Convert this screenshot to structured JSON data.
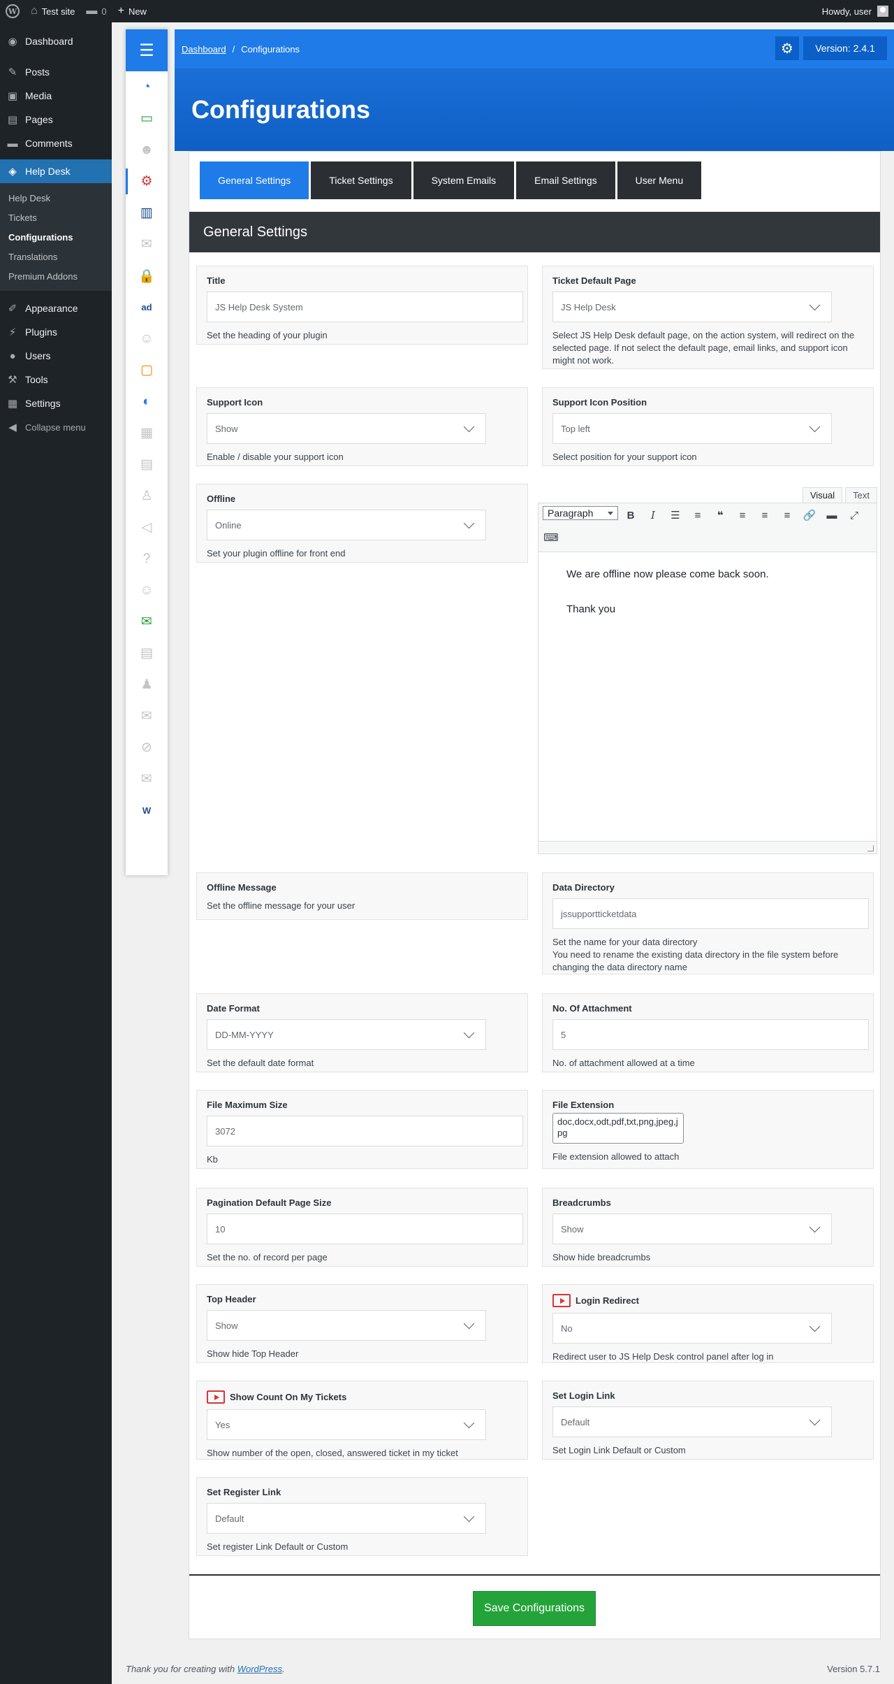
{
  "adminbar": {
    "site_name": "Test site",
    "comments_count": "0",
    "new_label": "New",
    "howdy": "Howdy, user"
  },
  "sidebar": {
    "items_top": [
      {
        "label": "Dashboard",
        "icon": "dashboard-icon",
        "glyph": "◉"
      },
      {
        "label": "Posts",
        "icon": "pin-icon",
        "glyph": "✎"
      },
      {
        "label": "Media",
        "icon": "media-icon",
        "glyph": "▣"
      },
      {
        "label": "Pages",
        "icon": "pages-icon",
        "glyph": "▤"
      },
      {
        "label": "Comments",
        "icon": "comment-icon",
        "glyph": "▬"
      }
    ],
    "current": {
      "label": "Help Desk",
      "icon": "ticket-icon",
      "glyph": "◈"
    },
    "submenu": [
      "Help Desk",
      "Tickets",
      "Configurations",
      "Translations",
      "Premium Addons"
    ],
    "items_bottom": [
      {
        "label": "Appearance",
        "icon": "brush-icon",
        "glyph": "✐"
      },
      {
        "label": "Plugins",
        "icon": "plug-icon",
        "glyph": "⚡"
      },
      {
        "label": "Users",
        "icon": "user-icon",
        "glyph": "●"
      },
      {
        "label": "Tools",
        "icon": "wrench-icon",
        "glyph": "⚒"
      },
      {
        "label": "Settings",
        "icon": "settings-icon",
        "glyph": "▦"
      }
    ],
    "collapse": "Collapse menu"
  },
  "strip_icons": [
    {
      "name": "dashboard-gauge-icon",
      "glyph": "◔",
      "color": "#1e7be8"
    },
    {
      "name": "tickets-icon",
      "glyph": "▭",
      "color": "#24a33a"
    },
    {
      "name": "agents-icon",
      "glyph": "☻",
      "color": "#c3c4c7"
    },
    {
      "name": "configurations-gear-icon",
      "glyph": "⚙",
      "color": "#d63638"
    },
    {
      "name": "reports-chart-icon",
      "glyph": "▥",
      "color": "#1e4d8c"
    },
    {
      "name": "email-icon",
      "glyph": "✉",
      "color": "#c3c4c7"
    },
    {
      "name": "lock-icon",
      "glyph": "🔒",
      "color": "#f0b400"
    },
    {
      "name": "ad-icon",
      "glyph": "ad",
      "color": "#1e4d8c"
    },
    {
      "name": "smile-icon",
      "glyph": "☺",
      "color": "#c3c4c7"
    },
    {
      "name": "id-card-icon",
      "glyph": "▢",
      "color": "#f08c00"
    },
    {
      "name": "circle-c-icon",
      "glyph": "◐",
      "color": "#1e7be8"
    },
    {
      "name": "grid-icon",
      "glyph": "▦",
      "color": "#c3c4c7"
    },
    {
      "name": "document-icon",
      "glyph": "▤",
      "color": "#c3c4c7"
    },
    {
      "name": "user-upload-icon",
      "glyph": "♙",
      "color": "#c3c4c7"
    },
    {
      "name": "megaphone-icon",
      "glyph": "◁",
      "color": "#c3c4c7"
    },
    {
      "name": "help-icon",
      "glyph": "?",
      "color": "#c3c4c7"
    },
    {
      "name": "support-agent-icon",
      "glyph": "☺",
      "color": "#c3c4c7"
    },
    {
      "name": "inbox-icon",
      "glyph": "✉",
      "color": "#24a33a"
    },
    {
      "name": "report-icon",
      "glyph": "▤",
      "color": "#c3c4c7"
    },
    {
      "name": "user-settings-icon",
      "glyph": "♟",
      "color": "#c3c4c7"
    },
    {
      "name": "mail-icon",
      "glyph": "✉",
      "color": "#c3c4c7"
    },
    {
      "name": "ban-icon",
      "glyph": "⊘",
      "color": "#c3c4c7"
    },
    {
      "name": "mail-open-icon",
      "glyph": "✉",
      "color": "#c3c4c7"
    },
    {
      "name": "word-icon",
      "glyph": "W",
      "color": "#1e4d8c"
    }
  ],
  "header": {
    "breadcrumb_home": "Dashboard",
    "breadcrumb_sep": "/",
    "breadcrumb_current": "Configurations",
    "version": "Version: 2.4.1",
    "page_title": "Configurations"
  },
  "tabs": [
    "General Settings",
    "Ticket Settings",
    "System Emails",
    "Email Settings",
    "User Menu"
  ],
  "section_title": "General Settings",
  "fields": {
    "title": {
      "label": "Title",
      "value": "JS Help Desk System",
      "desc": "Set the heading of your plugin"
    },
    "ticket_default_page": {
      "label": "Ticket Default Page",
      "value": "JS Help Desk",
      "desc": "Select JS Help Desk default page, on the action system, will redirect on the selected page. If not select the default page, email links, and support icon might not work."
    },
    "support_icon": {
      "label": "Support Icon",
      "value": "Show",
      "desc": "Enable / disable your support icon"
    },
    "support_icon_position": {
      "label": "Support Icon Position",
      "value": "Top left",
      "desc": "Select position for your support icon"
    },
    "offline": {
      "label": "Offline",
      "value": "Online",
      "desc": "Set your plugin offline for front end"
    },
    "offline_message": {
      "label": "Offline Message",
      "desc": "Set the offline message for your user"
    },
    "data_directory": {
      "label": "Data Directory",
      "value": "jssupportticketdata",
      "desc1": "Set the name for your data directory",
      "desc2": "You need to rename the existing data directory in the file system before changing the data directory name"
    },
    "date_format": {
      "label": "Date Format",
      "value": "DD-MM-YYYY",
      "desc": "Set the default date format"
    },
    "no_of_attachment": {
      "label": "No. Of Attachment",
      "value": "5",
      "desc": "No. of attachment allowed at a time"
    },
    "file_max_size": {
      "label": "File Maximum Size",
      "value": "3072",
      "desc": "Kb"
    },
    "file_extension": {
      "label": "File Extension",
      "value": "doc,docx,odt,pdf,txt,png,jpeg,jpg",
      "desc": "File extension allowed to attach"
    },
    "pagination": {
      "label": "Pagination Default Page Size",
      "value": "10",
      "desc": "Set the no. of record per page"
    },
    "breadcrumbs": {
      "label": "Breadcrumbs",
      "value": "Show",
      "desc": "Show hide breadcrumbs"
    },
    "top_header": {
      "label": "Top Header",
      "value": "Show",
      "desc": "Show hide Top Header"
    },
    "login_redirect": {
      "label": "Login Redirect",
      "value": "No",
      "desc": "Redirect user to JS Help Desk control panel after log in"
    },
    "show_count": {
      "label": "Show Count On My Tickets",
      "value": "Yes",
      "desc": "Show number of the open, closed, answered ticket in my ticket"
    },
    "login_link": {
      "label": "Set Login Link",
      "value": "Default",
      "desc": "Set Login Link Default or Custom"
    },
    "register_link": {
      "label": "Set Register Link",
      "value": "Default",
      "desc": "Set register Link Default or Custom"
    }
  },
  "editor": {
    "tab_visual": "Visual",
    "tab_text": "Text",
    "format": "Paragraph",
    "line1": "We are offline now please come back soon.",
    "line2": "Thank you"
  },
  "save_label": "Save Configurations",
  "footer": {
    "thanks": "Thank you for creating with",
    "wp_link": "WordPress",
    "wp_version": "Version 5.7.1"
  }
}
